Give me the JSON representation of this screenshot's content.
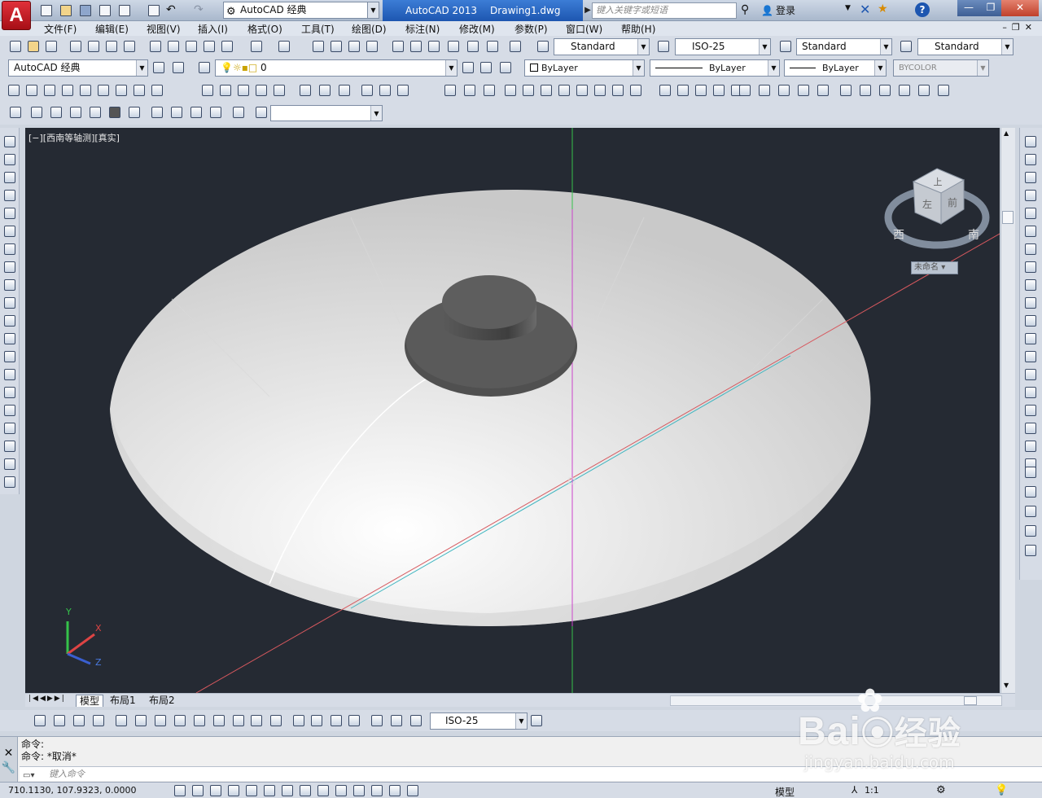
{
  "app": {
    "logo_letter": "A",
    "workspace": "AutoCAD 经典",
    "title_app": "AutoCAD 2013",
    "title_file": "Drawing1.dwg",
    "search_placeholder": "键入关键字或短语",
    "login": "登录",
    "help": "?"
  },
  "menu": [
    "文件(F)",
    "编辑(E)",
    "视图(V)",
    "插入(I)",
    "格式(O)",
    "工具(T)",
    "绘图(D)",
    "标注(N)",
    "修改(M)",
    "参数(P)",
    "窗口(W)",
    "帮助(H)"
  ],
  "styles": {
    "text_style": "Standard",
    "dim_style": "ISO-25",
    "table_style": "Standard",
    "mleader_style": "Standard"
  },
  "layers": {
    "workspace2": "AutoCAD 经典",
    "current_layer": "0",
    "color": "ByLayer",
    "linetype": "ByLayer",
    "lineweight": "ByLayer",
    "plot_style": "BYCOLOR"
  },
  "viewport": {
    "label": "[−][西南等轴测][真实]",
    "viewcube_top": "上",
    "viewcube_front": "前",
    "viewcube_left": "左",
    "compass_west": "西",
    "compass_south": "南",
    "viewcube_name": "未命名",
    "ucs_x": "X",
    "ucs_y": "Y",
    "ucs_z": "Z",
    "bg_color": "#252a33",
    "object_color": "#d6d6d6",
    "knob_color": "#555555"
  },
  "tabs": [
    "模型",
    "布局1",
    "布局2"
  ],
  "dim_toolbar": {
    "dim_style": "ISO-25"
  },
  "command": {
    "history": [
      "命令:",
      "命令: *取消*"
    ],
    "input_placeholder": "键入命令"
  },
  "status": {
    "coords": "710.1130,  107.9323,  0.0000",
    "model": "模型",
    "scale": "1:1"
  },
  "watermark": {
    "brand": "Bai",
    "brand2": "经验",
    "url": "jingyan.baidu.com"
  }
}
